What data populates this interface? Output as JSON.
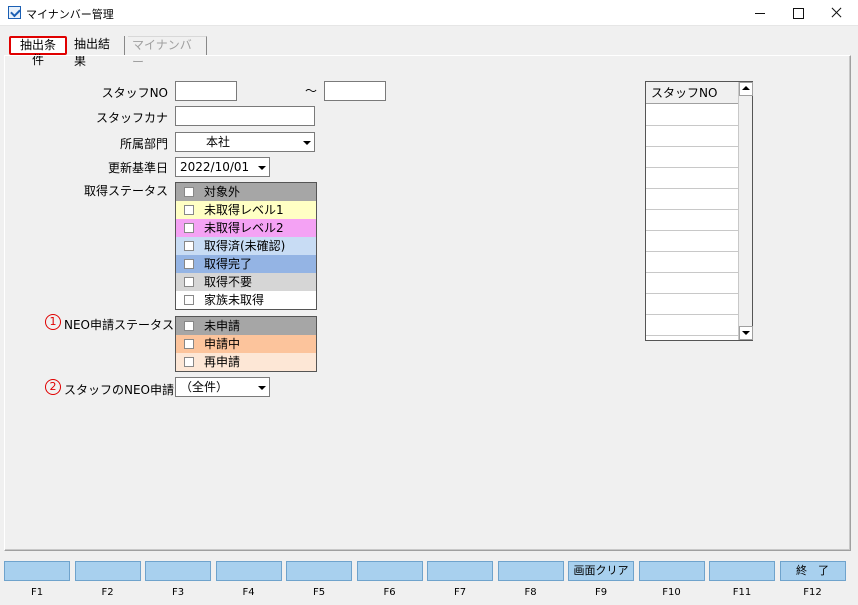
{
  "window": {
    "title": "マイナンバー管理"
  },
  "tabs": [
    {
      "label": "抽出条件"
    },
    {
      "label": "抽出結果"
    },
    {
      "label": "マイナンバー"
    }
  ],
  "form": {
    "staff_no": {
      "label": "スタッフNO",
      "from": "",
      "to": "",
      "separator": "～"
    },
    "staff_kana": {
      "label": "スタッフカナ",
      "value": ""
    },
    "department": {
      "label": "所属部門",
      "value": "本社"
    },
    "update_date": {
      "label": "更新基準日",
      "value": "2022/10/01"
    },
    "acquire_status": {
      "label": "取得ステータス",
      "items": [
        {
          "label": "対象外",
          "color": "#a6a6a6"
        },
        {
          "label": "未取得レベル1",
          "color": "#ffffc4"
        },
        {
          "label": "未取得レベル2",
          "color": "#f4a2f4"
        },
        {
          "label": "取得済(未確認)",
          "color": "#c8dcf4"
        },
        {
          "label": "取得完了",
          "color": "#94b4e4"
        },
        {
          "label": "取得不要",
          "color": "#d6d6d6"
        },
        {
          "label": "家族未取得",
          "color": "#ffffff"
        }
      ]
    },
    "neo_status": {
      "marker": "1",
      "label": "NEO申請ステータス",
      "items": [
        {
          "label": "未申請",
          "color": "#a6a6a6"
        },
        {
          "label": "申請中",
          "color": "#fcc49c"
        },
        {
          "label": "再申請",
          "color": "#fde7d6"
        }
      ]
    },
    "staff_neo": {
      "marker": "2",
      "label": "スタッフのNEO申請",
      "value": "（全件）"
    }
  },
  "staff_list": {
    "header": "スタッフNO",
    "rows": 11
  },
  "function_keys": [
    {
      "key": "F1",
      "label": ""
    },
    {
      "key": "F2",
      "label": ""
    },
    {
      "key": "F3",
      "label": ""
    },
    {
      "key": "F4",
      "label": ""
    },
    {
      "key": "F5",
      "label": ""
    },
    {
      "key": "F6",
      "label": ""
    },
    {
      "key": "F7",
      "label": ""
    },
    {
      "key": "F8",
      "label": ""
    },
    {
      "key": "F9",
      "label": "画面クリア"
    },
    {
      "key": "F10",
      "label": ""
    },
    {
      "key": "F11",
      "label": ""
    },
    {
      "key": "F12",
      "label": "終　了"
    }
  ]
}
